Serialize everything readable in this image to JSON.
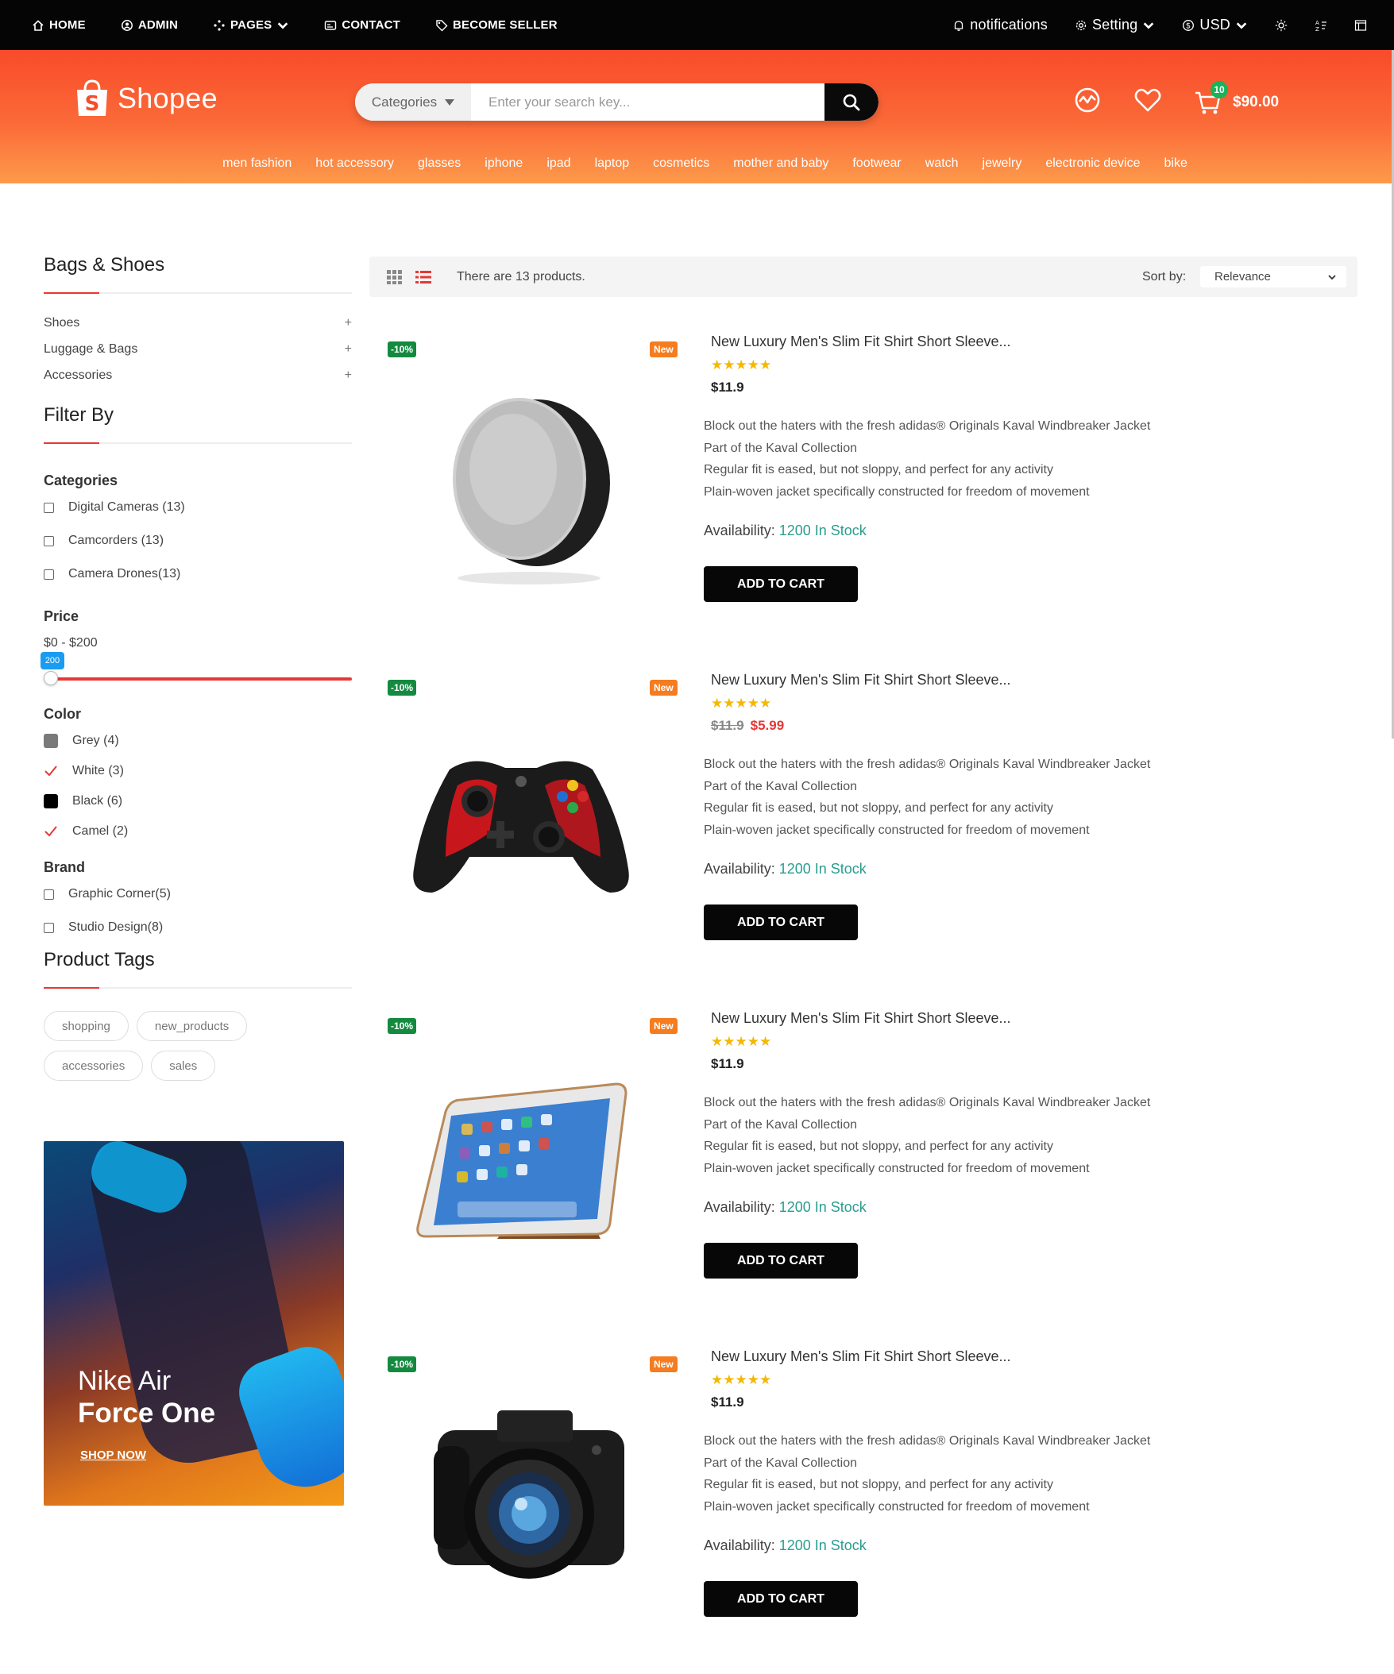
{
  "topnav": {
    "left": [
      {
        "label": "HOME",
        "icon": "home-icon"
      },
      {
        "label": "ADMIN",
        "icon": "admin-icon"
      },
      {
        "label": "PAGES",
        "icon": "pages-icon"
      },
      {
        "label": "CONTACT",
        "icon": "contact-icon"
      },
      {
        "label": "BECOME SELLER",
        "icon": "tag-icon"
      }
    ],
    "notifications": "notifications",
    "setting": "Setting",
    "currency": "USD"
  },
  "header": {
    "logo_text": "Shopee",
    "categories_label": "Categories",
    "search_placeholder": "Enter your search key...",
    "cart_count": "10",
    "cart_total": "$90.00",
    "category_links": [
      "men fashion",
      "hot accessory",
      "glasses",
      "iphone",
      "ipad",
      "laptop",
      "cosmetics",
      "mother and baby",
      "footwear",
      "watch",
      "jewelry",
      "electronic device",
      "bike"
    ]
  },
  "sidebar": {
    "title": "Bags & Shoes",
    "categories": [
      "Shoes",
      "Luggage & Bags",
      "Accessories"
    ],
    "filter_title": "Filter By",
    "categories_title": "Categories",
    "category_filters": [
      "Digital Cameras (13)",
      "Camcorders (13)",
      "Camera Drones(13)"
    ],
    "price_title": "Price",
    "price_range": "$0 - $200",
    "price_tip": "200",
    "color_title": "Color",
    "colors": [
      {
        "label": "Grey (4)",
        "swatch": "#777777",
        "checked": false
      },
      {
        "label": "White (3)",
        "swatch": "#ffffff",
        "checked": true
      },
      {
        "label": "Black (6)",
        "swatch": "#000000",
        "checked": false
      },
      {
        "label": "Camel (2)",
        "swatch": "#c19a6b",
        "checked": true
      }
    ],
    "brand_title": "Brand",
    "brands": [
      "Graphic Corner(5)",
      "Studio Design(8)"
    ],
    "tags_title": "Product Tags",
    "tags": [
      "shopping",
      "new_products",
      "accessories",
      "sales"
    ],
    "banner": {
      "line1": "Nike Air",
      "line2": "Force One",
      "cta": "SHOP NOW"
    }
  },
  "toolbar": {
    "count_text": "There are 13 products.",
    "sort_label": "Sort by:",
    "sort_value": "Relevance"
  },
  "products": [
    {
      "title": "New Luxury Men's Slim Fit Shirt Short Sleeve...",
      "discount": "-10%",
      "badge": "New",
      "stars": "★★★★★",
      "price": "$11.9",
      "old_price": "",
      "new_price": "",
      "image": "speaker",
      "desc": [
        "Block out the haters with the fresh adidas® Originals Kaval Windbreaker Jacket",
        "Part of the Kaval Collection",
        "Regular fit is eased, but not sloppy, and perfect for any activity",
        "Plain-woven jacket specifically constructed for freedom of movement"
      ],
      "availability_label": "Availability:",
      "availability_value": "1200 In Stock",
      "cta": "ADD TO CART"
    },
    {
      "title": "New Luxury Men's Slim Fit Shirt Short Sleeve...",
      "discount": "-10%",
      "badge": "New",
      "stars": "★★★★★",
      "price": "",
      "old_price": "$11.9",
      "new_price": "$5.99",
      "image": "gamepad",
      "desc": [
        "Block out the haters with the fresh adidas® Originals Kaval Windbreaker Jacket",
        "Part of the Kaval Collection",
        "Regular fit is eased, but not sloppy, and perfect for any activity",
        "Plain-woven jacket specifically constructed for freedom of movement"
      ],
      "availability_label": "Availability:",
      "availability_value": "1200 In Stock",
      "cta": "ADD TO CART"
    },
    {
      "title": "New Luxury Men's Slim Fit Shirt Short Sleeve...",
      "discount": "-10%",
      "badge": "New",
      "stars": "★★★★★",
      "price": "$11.9",
      "old_price": "",
      "new_price": "",
      "image": "tablet",
      "desc": [
        "Block out the haters with the fresh adidas® Originals Kaval Windbreaker Jacket",
        "Part of the Kaval Collection",
        "Regular fit is eased, but not sloppy, and perfect for any activity",
        "Plain-woven jacket specifically constructed for freedom of movement"
      ],
      "availability_label": "Availability:",
      "availability_value": "1200 In Stock",
      "cta": "ADD TO CART"
    },
    {
      "title": "New Luxury Men's Slim Fit Shirt Short Sleeve...",
      "discount": "-10%",
      "badge": "New",
      "stars": "★★★★★",
      "price": "$11.9",
      "old_price": "",
      "new_price": "",
      "image": "camera",
      "desc": [
        "Block out the haters with the fresh adidas® Originals Kaval Windbreaker Jacket",
        "Part of the Kaval Collection",
        "Regular fit is eased, but not sloppy, and perfect for any activity",
        "Plain-woven jacket specifically constructed for freedom of movement"
      ],
      "availability_label": "Availability:",
      "availability_value": "1200 In Stock",
      "cta": "ADD TO CART"
    }
  ],
  "colors": {
    "brand": "#f94b2a",
    "accent": "#e53935",
    "stock": "#2a9d8f",
    "discount": "#138a3f",
    "new_badge": "#f57c1f"
  }
}
